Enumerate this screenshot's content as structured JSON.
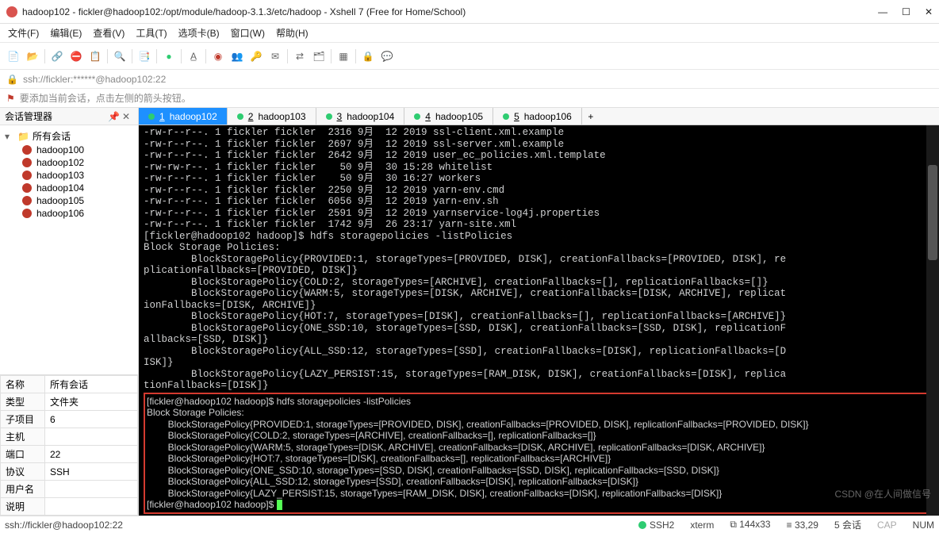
{
  "window": {
    "title": "hadoop102 - fickler@hadoop102:/opt/module/hadoop-3.1.3/etc/hadoop - Xshell 7 (Free for Home/School)"
  },
  "menubar": [
    "文件(F)",
    "编辑(E)",
    "查看(V)",
    "工具(T)",
    "选项卡(B)",
    "窗口(W)",
    "帮助(H)"
  ],
  "addressbar": {
    "text": "ssh://fickler:******@hadoop102:22"
  },
  "hintbar": {
    "text": "要添加当前会话，点击左侧的箭头按钮。"
  },
  "sidebar": {
    "header": "会话管理器",
    "folder": "所有会话",
    "items": [
      "hadoop100",
      "hadoop102",
      "hadoop103",
      "hadoop104",
      "hadoop105",
      "hadoop106"
    ]
  },
  "props": {
    "rows": [
      {
        "k": "名称",
        "v": "所有会话"
      },
      {
        "k": "类型",
        "v": "文件夹"
      },
      {
        "k": "子项目",
        "v": "6"
      },
      {
        "k": "主机",
        "v": ""
      },
      {
        "k": "端口",
        "v": "22"
      },
      {
        "k": "协议",
        "v": "SSH"
      },
      {
        "k": "用户名",
        "v": ""
      },
      {
        "k": "说明",
        "v": ""
      }
    ]
  },
  "tabs": {
    "items": [
      {
        "num": "1",
        "label": "hadoop102",
        "active": true
      },
      {
        "num": "2",
        "label": "hadoop103"
      },
      {
        "num": "3",
        "label": "hadoop104"
      },
      {
        "num": "4",
        "label": "hadoop105"
      },
      {
        "num": "5",
        "label": "hadoop106"
      }
    ],
    "add": "+"
  },
  "terminal": {
    "top_lines": [
      "-rw-r--r--. 1 fickler fickler  2316 9月  12 2019 ssl-client.xml.example",
      "-rw-r--r--. 1 fickler fickler  2697 9月  12 2019 ssl-server.xml.example",
      "-rw-r--r--. 1 fickler fickler  2642 9月  12 2019 user_ec_policies.xml.template",
      "-rw-rw-r--. 1 fickler fickler    50 9月  30 15:28 whitelist",
      "-rw-r--r--. 1 fickler fickler    50 9月  30 16:27 workers",
      "-rw-r--r--. 1 fickler fickler  2250 9月  12 2019 yarn-env.cmd",
      "-rw-r--r--. 1 fickler fickler  6056 9月  12 2019 yarn-env.sh",
      "-rw-r--r--. 1 fickler fickler  2591 9月  12 2019 yarnservice-log4j.properties",
      "-rw-r--r--. 1 fickler fickler  1742 9月  26 23:17 yarn-site.xml",
      "[fickler@hadoop102 hadoop]$ hdfs storagepolicies -listPolicies",
      "Block Storage Policies:",
      "        BlockStoragePolicy{PROVIDED:1, storageTypes=[PROVIDED, DISK], creationFallbacks=[PROVIDED, DISK], re",
      "plicationFallbacks=[PROVIDED, DISK]}",
      "        BlockStoragePolicy{COLD:2, storageTypes=[ARCHIVE], creationFallbacks=[], replicationFallbacks=[]}",
      "        BlockStoragePolicy{WARM:5, storageTypes=[DISK, ARCHIVE], creationFallbacks=[DISK, ARCHIVE], replicat",
      "ionFallbacks=[DISK, ARCHIVE]}",
      "        BlockStoragePolicy{HOT:7, storageTypes=[DISK], creationFallbacks=[], replicationFallbacks=[ARCHIVE]}",
      "        BlockStoragePolicy{ONE_SSD:10, storageTypes=[SSD, DISK], creationFallbacks=[SSD, DISK], replicationF",
      "allbacks=[SSD, DISK]}",
      "        BlockStoragePolicy{ALL_SSD:12, storageTypes=[SSD], creationFallbacks=[DISK], replicationFallbacks=[D",
      "ISK]}",
      "        BlockStoragePolicy{LAZY_PERSIST:15, storageTypes=[RAM_DISK, DISK], creationFallbacks=[DISK], replica",
      "tionFallbacks=[DISK]}"
    ],
    "red_lines": [
      "[fickler@hadoop102 hadoop]$ hdfs storagepolicies -listPolicies",
      "Block Storage Policies:",
      "        BlockStoragePolicy{PROVIDED:1, storageTypes=[PROVIDED, DISK], creationFallbacks=[PROVIDED, DISK], replicationFallbacks=[PROVIDED, DISK]}",
      "        BlockStoragePolicy{COLD:2, storageTypes=[ARCHIVE], creationFallbacks=[], replicationFallbacks=[]}",
      "        BlockStoragePolicy{WARM:5, storageTypes=[DISK, ARCHIVE], creationFallbacks=[DISK, ARCHIVE], replicationFallbacks=[DISK, ARCHIVE]}",
      "        BlockStoragePolicy{HOT:7, storageTypes=[DISK], creationFallbacks=[], replicationFallbacks=[ARCHIVE]}",
      "        BlockStoragePolicy{ONE_SSD:10, storageTypes=[SSD, DISK], creationFallbacks=[SSD, DISK], replicationFallbacks=[SSD, DISK]}",
      "        BlockStoragePolicy{ALL_SSD:12, storageTypes=[SSD], creationFallbacks=[DISK], replicationFallbacks=[DISK]}",
      "        BlockStoragePolicy{LAZY_PERSIST:15, storageTypes=[RAM_DISK, DISK], creationFallbacks=[DISK], replicationFallbacks=[DISK]}"
    ],
    "prompt": "[fickler@hadoop102 hadoop]$ "
  },
  "statusbar": {
    "left": "ssh://fickler@hadoop102:22",
    "ssh": "SSH2",
    "term": "xterm",
    "size": "144x33",
    "pos": "33,29",
    "sess": "5 会话",
    "cap": "CAP",
    "num": "NUM",
    "watermark": "CSDN @在人间做信号"
  }
}
